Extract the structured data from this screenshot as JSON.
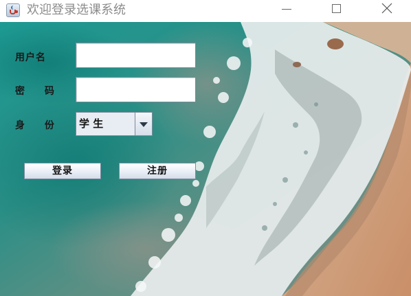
{
  "window": {
    "title": "欢迎登录选课系统"
  },
  "form": {
    "username_label": "用户名",
    "username_value": "",
    "password_label": "密 码",
    "password_value": "",
    "role_label": "身 份",
    "role_selected": "学 生"
  },
  "buttons": {
    "login_label": "登录",
    "register_label": "注册"
  },
  "icons": {
    "app": "java-cup-icon",
    "minimize": "minimize-icon",
    "maximize": "maximize-icon",
    "close": "close-icon",
    "dropdown": "chevron-down-icon"
  },
  "colors": {
    "sea": "#1f8f8a",
    "foam": "#f2f4f4",
    "sand": "#d9a27a"
  }
}
